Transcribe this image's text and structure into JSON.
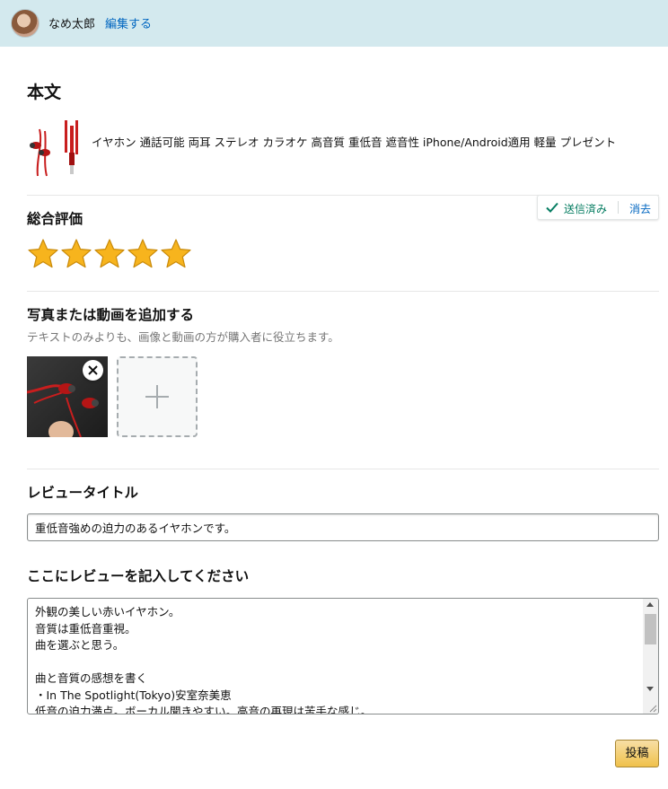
{
  "header": {
    "username": "なめ太郎",
    "edit_label": "編集する"
  },
  "main": {
    "heading": "本文",
    "product_title": "イヤホン 通話可能 両耳 ステレオ カラオケ 高音質 重低音 遮音性 iPhone/Android適用 軽量 プレゼント"
  },
  "rating": {
    "heading": "総合評価",
    "status_text": "送信済み",
    "clear_label": "消去",
    "value": 5,
    "max": 5,
    "star_color": "#f7b41d"
  },
  "media": {
    "heading": "写真または動画を追加する",
    "subtext": "テキストのみよりも、画像と動画の方が購入者に役立ちます。"
  },
  "review_title": {
    "heading": "レビュータイトル",
    "value": "重低音強めの迫力のあるイヤホンです。"
  },
  "review_body": {
    "heading": "ここにレビューを記入してください",
    "value": "外観の美しい赤いイヤホン。\n音質は重低音重視。\n曲を選ぶと思う。\n\n曲と音質の感想を書く\n・In The Spotlight(Tokyo)安室奈美恵\n低音の迫力満点。ボーカル聞きやすい。高音の再現は苦手な感じ。"
  },
  "submit_label": "投稿",
  "colors": {
    "header_bg": "#d3e9ee",
    "link": "#0066c0",
    "success": "#067d62",
    "button": "#f0c14b"
  }
}
